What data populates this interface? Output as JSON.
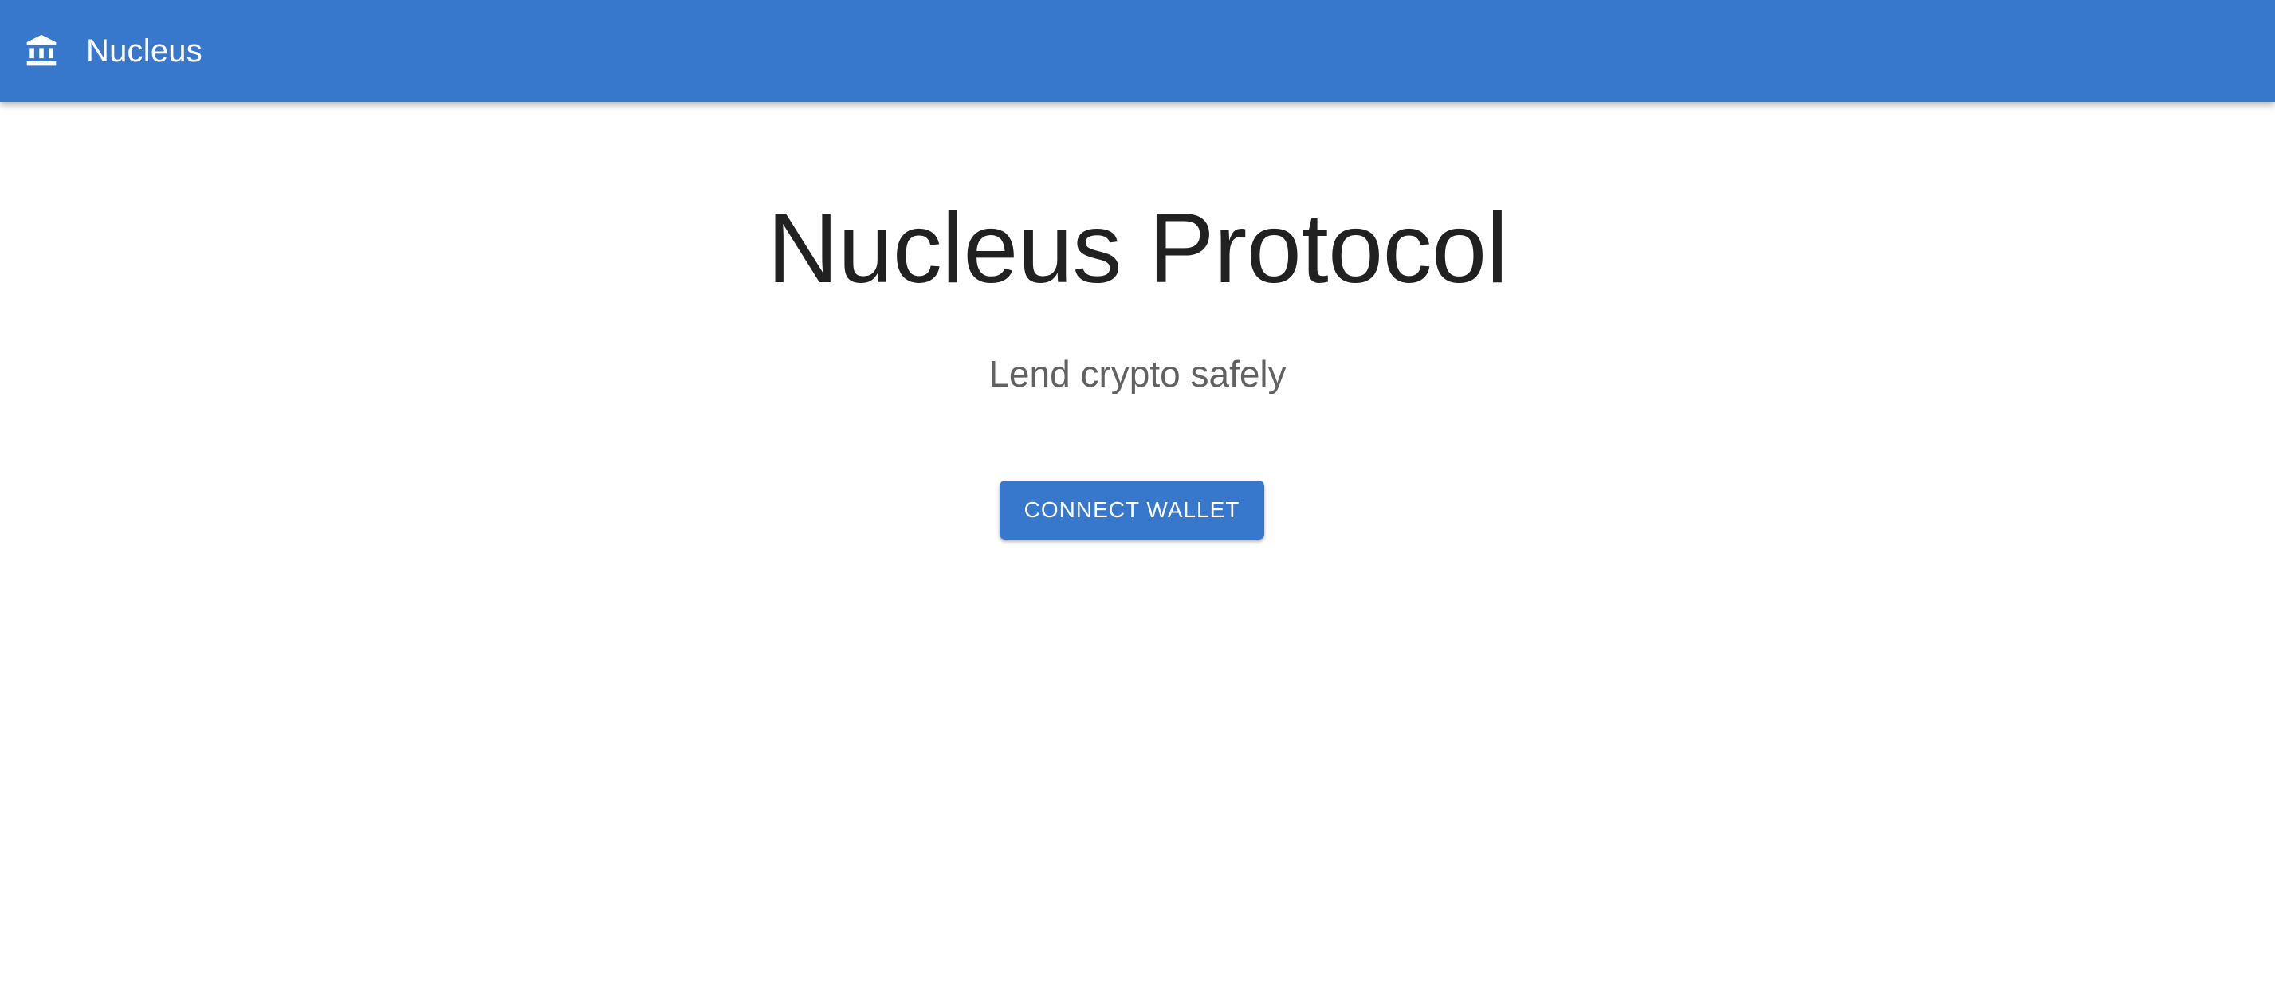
{
  "appbar": {
    "brand_icon": "bank-icon",
    "brand_name": "Nucleus",
    "background_color": "#3778cd"
  },
  "hero": {
    "title": "Nucleus Protocol",
    "subtitle": "Lend crypto safely",
    "connect_button_label": "CONNECT WALLET"
  },
  "colors": {
    "primary": "#3778cd",
    "title_text": "#212121",
    "subtitle_text": "#616161",
    "background": "#ffffff"
  }
}
